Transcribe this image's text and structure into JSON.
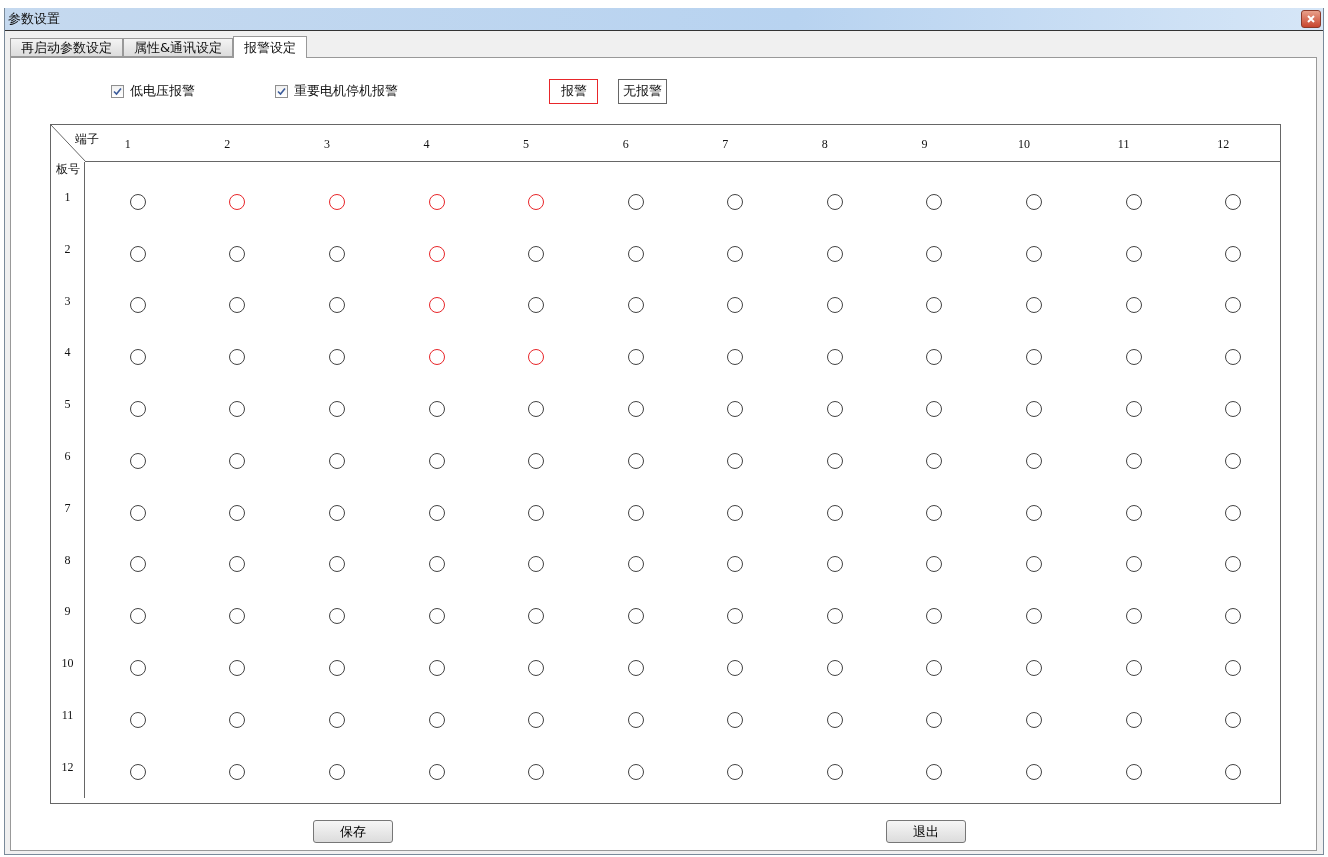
{
  "window": {
    "title": "参数设置"
  },
  "tabs": [
    {
      "label": "再启动参数设定",
      "selected": false
    },
    {
      "label": "属性&通讯设定",
      "selected": false
    },
    {
      "label": "报警设定",
      "selected": true
    }
  ],
  "options": [
    {
      "label": "低电压报警",
      "checked": true
    },
    {
      "label": "重要电机停机报警",
      "checked": true
    }
  ],
  "legend": [
    {
      "label": "报警",
      "color": "#e8262a"
    },
    {
      "label": "无报警",
      "color": "#666666"
    }
  ],
  "grid": {
    "corner_top": "端子",
    "corner_left": "板号",
    "columns": [
      "1",
      "2",
      "3",
      "4",
      "5",
      "6",
      "7",
      "8",
      "9",
      "10",
      "11",
      "12"
    ],
    "rows": [
      {
        "label": "1",
        "cells": [
          {
            "alarm": false
          },
          {
            "alarm": true
          },
          {
            "alarm": true
          },
          {
            "alarm": true
          },
          {
            "alarm": true
          },
          {
            "alarm": false
          },
          {
            "alarm": false
          },
          {
            "alarm": false
          },
          {
            "alarm": false
          },
          {
            "alarm": false
          },
          {
            "alarm": false
          },
          {
            "alarm": false
          }
        ]
      },
      {
        "label": "2",
        "cells": [
          {
            "alarm": false
          },
          {
            "alarm": false
          },
          {
            "alarm": false
          },
          {
            "alarm": true
          },
          {
            "alarm": false
          },
          {
            "alarm": false
          },
          {
            "alarm": false
          },
          {
            "alarm": false
          },
          {
            "alarm": false
          },
          {
            "alarm": false
          },
          {
            "alarm": false
          },
          {
            "alarm": false
          }
        ]
      },
      {
        "label": "3",
        "cells": [
          {
            "alarm": false
          },
          {
            "alarm": false
          },
          {
            "alarm": false
          },
          {
            "alarm": true
          },
          {
            "alarm": false
          },
          {
            "alarm": false
          },
          {
            "alarm": false
          },
          {
            "alarm": false
          },
          {
            "alarm": false
          },
          {
            "alarm": false
          },
          {
            "alarm": false
          },
          {
            "alarm": false
          }
        ]
      },
      {
        "label": "4",
        "cells": [
          {
            "alarm": false
          },
          {
            "alarm": false
          },
          {
            "alarm": false
          },
          {
            "alarm": true
          },
          {
            "alarm": true
          },
          {
            "alarm": false
          },
          {
            "alarm": false
          },
          {
            "alarm": false
          },
          {
            "alarm": false
          },
          {
            "alarm": false
          },
          {
            "alarm": false
          },
          {
            "alarm": false
          }
        ]
      },
      {
        "label": "5",
        "cells": [
          {
            "alarm": false
          },
          {
            "alarm": false
          },
          {
            "alarm": false
          },
          {
            "alarm": false
          },
          {
            "alarm": false
          },
          {
            "alarm": false
          },
          {
            "alarm": false
          },
          {
            "alarm": false
          },
          {
            "alarm": false
          },
          {
            "alarm": false
          },
          {
            "alarm": false
          },
          {
            "alarm": false
          }
        ]
      },
      {
        "label": "6",
        "cells": [
          {
            "alarm": false
          },
          {
            "alarm": false
          },
          {
            "alarm": false
          },
          {
            "alarm": false
          },
          {
            "alarm": false
          },
          {
            "alarm": false
          },
          {
            "alarm": false
          },
          {
            "alarm": false
          },
          {
            "alarm": false
          },
          {
            "alarm": false
          },
          {
            "alarm": false
          },
          {
            "alarm": false
          }
        ]
      },
      {
        "label": "7",
        "cells": [
          {
            "alarm": false
          },
          {
            "alarm": false
          },
          {
            "alarm": false
          },
          {
            "alarm": false
          },
          {
            "alarm": false
          },
          {
            "alarm": false
          },
          {
            "alarm": false
          },
          {
            "alarm": false
          },
          {
            "alarm": false
          },
          {
            "alarm": false
          },
          {
            "alarm": false
          },
          {
            "alarm": false
          }
        ]
      },
      {
        "label": "8",
        "cells": [
          {
            "alarm": false
          },
          {
            "alarm": false
          },
          {
            "alarm": false
          },
          {
            "alarm": false
          },
          {
            "alarm": false
          },
          {
            "alarm": false
          },
          {
            "alarm": false
          },
          {
            "alarm": false
          },
          {
            "alarm": false
          },
          {
            "alarm": false
          },
          {
            "alarm": false
          },
          {
            "alarm": false
          }
        ]
      },
      {
        "label": "9",
        "cells": [
          {
            "alarm": false
          },
          {
            "alarm": false
          },
          {
            "alarm": false
          },
          {
            "alarm": false
          },
          {
            "alarm": false
          },
          {
            "alarm": false
          },
          {
            "alarm": false
          },
          {
            "alarm": false
          },
          {
            "alarm": false
          },
          {
            "alarm": false
          },
          {
            "alarm": false
          },
          {
            "alarm": false
          }
        ]
      },
      {
        "label": "10",
        "cells": [
          {
            "alarm": false
          },
          {
            "alarm": false
          },
          {
            "alarm": false
          },
          {
            "alarm": false
          },
          {
            "alarm": false
          },
          {
            "alarm": false
          },
          {
            "alarm": false
          },
          {
            "alarm": false
          },
          {
            "alarm": false
          },
          {
            "alarm": false
          },
          {
            "alarm": false
          },
          {
            "alarm": false
          }
        ]
      },
      {
        "label": "11",
        "cells": [
          {
            "alarm": false
          },
          {
            "alarm": false
          },
          {
            "alarm": false
          },
          {
            "alarm": false
          },
          {
            "alarm": false
          },
          {
            "alarm": false
          },
          {
            "alarm": false
          },
          {
            "alarm": false
          },
          {
            "alarm": false
          },
          {
            "alarm": false
          },
          {
            "alarm": false
          },
          {
            "alarm": false
          }
        ]
      },
      {
        "label": "12",
        "cells": [
          {
            "alarm": false
          },
          {
            "alarm": false
          },
          {
            "alarm": false
          },
          {
            "alarm": false
          },
          {
            "alarm": false
          },
          {
            "alarm": false
          },
          {
            "alarm": false
          },
          {
            "alarm": false
          },
          {
            "alarm": false
          },
          {
            "alarm": false
          },
          {
            "alarm": false
          },
          {
            "alarm": false
          }
        ]
      }
    ]
  },
  "buttons": [
    {
      "label": "保存"
    },
    {
      "label": "退出"
    }
  ]
}
